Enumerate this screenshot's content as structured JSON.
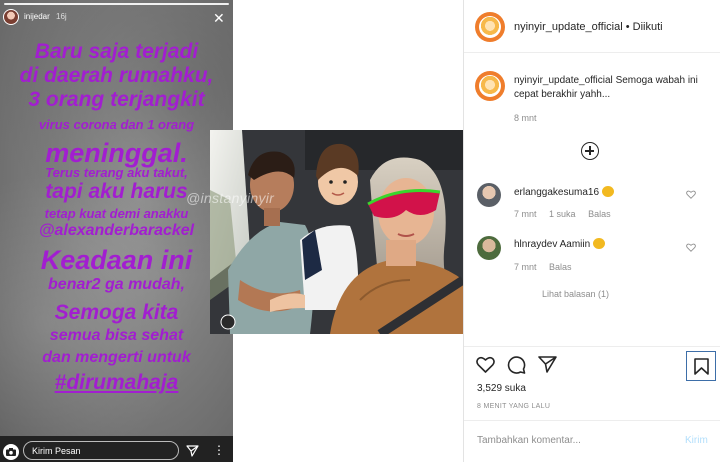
{
  "story": {
    "username": "inijedar",
    "time": "16j",
    "text_lines": [
      "Baru saja terjadi",
      "di daerah rumahku,",
      "3 orang terjangkit",
      "virus corona dan 1 orang",
      "meninggal.",
      "Terus terang aku takut,",
      "tapi aku harus",
      "tetap kuat demi anakku",
      "@alexanderbarackel",
      "Keadaan ini",
      "benar2 ga mudah,",
      "Semoga kita",
      "semua bisa sehat",
      "dan mengerti untuk",
      "#dirumahaja"
    ],
    "message_placeholder": "Kirim Pesan"
  },
  "photo": {
    "watermark": "@instanyinyir"
  },
  "post": {
    "header_username": "nyinyir_update_official",
    "header_separator": "•",
    "follow_status": "Diikuti",
    "caption_username": "nyinyir_update_official",
    "caption_text": "Semoga wabah ini cepat berakhir yahh...",
    "caption_time": "8 mnt",
    "comments": [
      {
        "username": "erlanggakesuma16",
        "text": "",
        "time": "7 mnt",
        "likes": "1 suka",
        "reply": "Balas"
      },
      {
        "username": "hlnraydev",
        "text": "Aamiin",
        "time": "7 mnt",
        "likes": "",
        "reply": "Balas"
      }
    ],
    "view_replies": "Lihat balasan (1)",
    "like_count": "3,529 suka",
    "post_time": "8 MENIT YANG LALU",
    "comment_placeholder": "Tambahkan komentar...",
    "post_button": "Kirim"
  },
  "colors": {
    "story_text": "#a21ed0",
    "avatar_ring": "#ef7d2c",
    "secondary_text": "#8e8e8e",
    "post_button_disabled": "#b2dffc"
  }
}
